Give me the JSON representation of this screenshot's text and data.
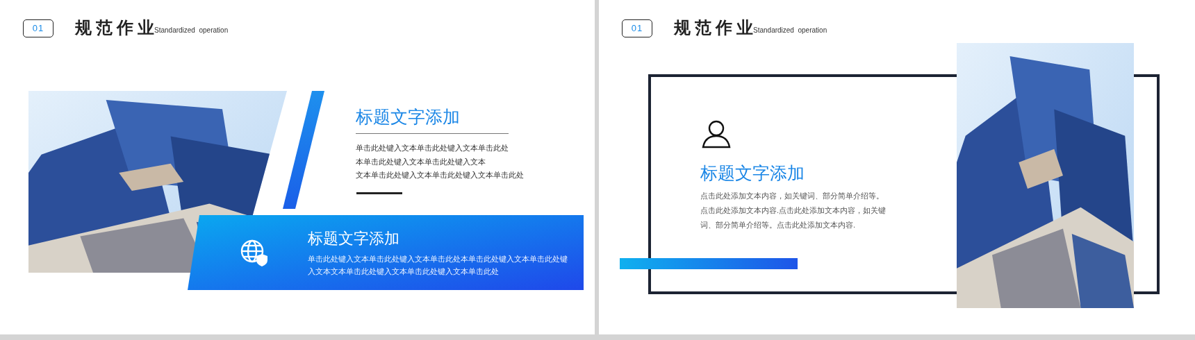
{
  "slides": [
    {
      "kind": "diagonal",
      "number": "01",
      "title": "规范作业",
      "subtitle": "Standardized  operation",
      "heading": "标题文字添加",
      "body_lines": [
        "单击此处键入文本单击此处键入文本单击此处",
        "本单击此处键入文本单击此处键入文本",
        "文本单击此处键入文本单击此处键入文本单击此处"
      ],
      "banner": {
        "title": "标题文字添加",
        "body_lines": [
          "单击此处键入文本单击此处键入文本单击此处本单击此处键入文本单击此处键",
          "入文本文本单击此处键入文本单击此处键入文本单击此处"
        ]
      }
    },
    {
      "kind": "framed",
      "number": "01",
      "title": "规范作业",
      "subtitle": "Standardized  operation",
      "heading": "标题文字添加",
      "body_lines": [
        "点击此处添加文本内容，如关键词、部分简单介绍等。",
        "点击此处添加文本内容.点击此处添加文本内容，如关键",
        "词、部分简单介绍等。点击此处添加文本内容."
      ]
    }
  ]
}
